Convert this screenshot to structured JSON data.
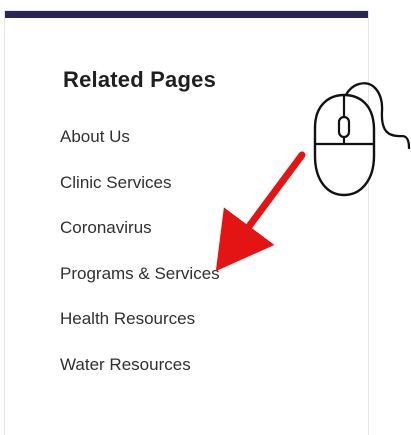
{
  "sidebar": {
    "title": "Related Pages",
    "links": [
      "About Us",
      "Clinic Services",
      "Coronavirus",
      "Programs & Services",
      "Health Resources",
      "Water Resources"
    ]
  },
  "colors": {
    "top_bar": "#282654",
    "arrow": "#e51414",
    "text": "#303030"
  },
  "icons": {
    "mouse": "computer-mouse-icon",
    "arrow": "red-arrow-icon"
  }
}
